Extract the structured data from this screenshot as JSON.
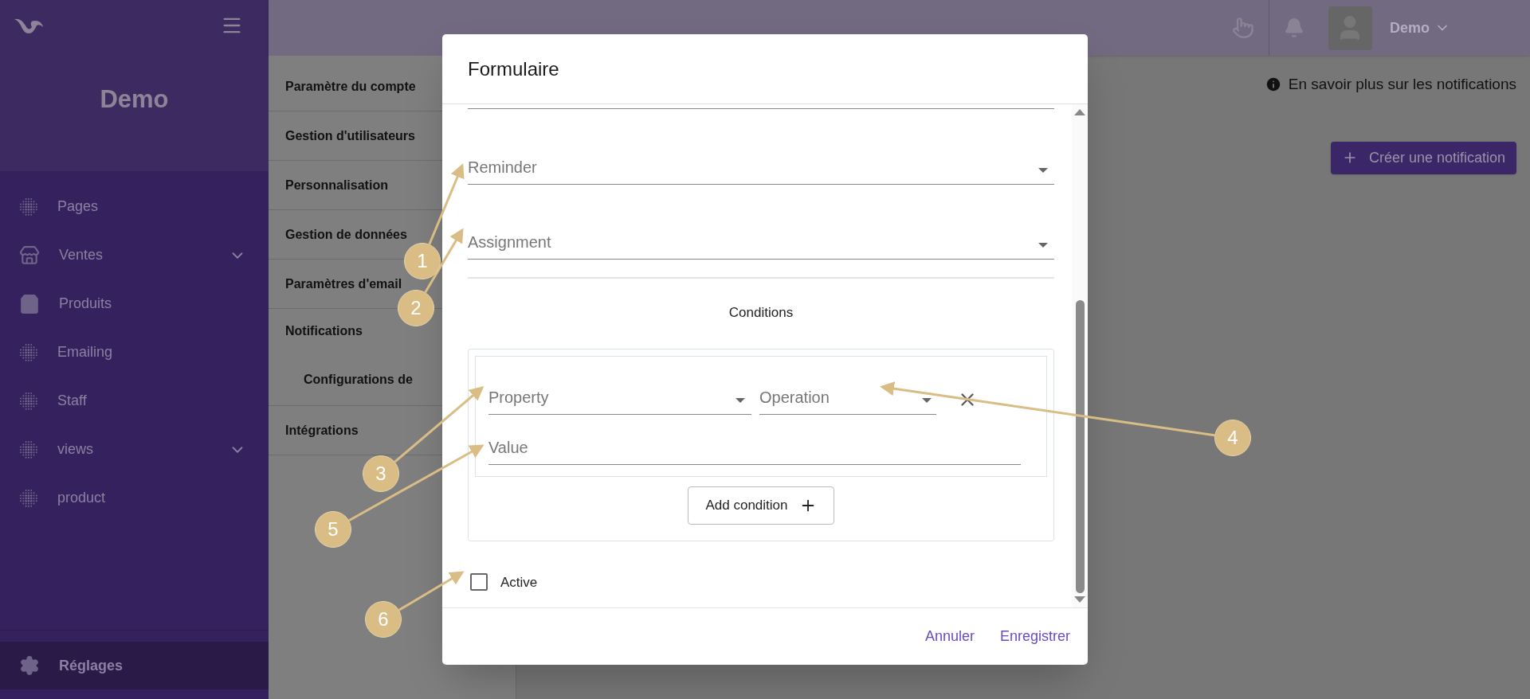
{
  "sidebar": {
    "title": "Demo",
    "items": [
      {
        "label": "Pages",
        "kind": "dots",
        "expandable": false,
        "selected": false
      },
      {
        "label": "Ventes",
        "kind": "store",
        "expandable": true,
        "selected": false
      },
      {
        "label": "Produits",
        "kind": "bag",
        "expandable": false,
        "selected": false
      },
      {
        "label": "Emailing",
        "kind": "dots",
        "expandable": false,
        "selected": false
      },
      {
        "label": "Staff",
        "kind": "dots",
        "expandable": false,
        "selected": false
      },
      {
        "label": "views",
        "kind": "dots",
        "expandable": true,
        "selected": false
      },
      {
        "label": "product",
        "kind": "dots",
        "expandable": false,
        "selected": false
      }
    ],
    "footer_item": {
      "label": "Réglages",
      "selected": true
    }
  },
  "topbar": {
    "user": "Demo"
  },
  "settings_menu": {
    "items": [
      {
        "label": "Paramètre du compte",
        "kind": "section"
      },
      {
        "label": "Gestion d'utilisateurs",
        "kind": "section"
      },
      {
        "label": "Personnalisation",
        "kind": "section"
      },
      {
        "label": "Gestion de données",
        "kind": "section"
      },
      {
        "label": "Paramètres d'email",
        "kind": "section"
      },
      {
        "label": "Notifications",
        "kind": "group"
      },
      {
        "label": "Configurations de",
        "kind": "subitem"
      },
      {
        "label": "Intégrations",
        "kind": "section"
      }
    ]
  },
  "main": {
    "info_link": "En savoir plus sur les notifications",
    "create_button": "Créer une notification"
  },
  "dialog": {
    "title": "Formulaire",
    "fields": [
      {
        "kind": "select",
        "placeholder": "Reminder"
      },
      {
        "kind": "select",
        "placeholder": "Assignment"
      }
    ],
    "conditions_heading": "Conditions",
    "condition": {
      "property": "Property",
      "operation": "Operation",
      "placeholder": "Value"
    },
    "add_condition": "Add condition",
    "active": {
      "label": "Active",
      "checked": false
    },
    "buttons": [
      "Annuler",
      "Enregistrer"
    ]
  },
  "annotations": [
    {
      "number": "1"
    },
    {
      "number": "2"
    },
    {
      "number": "3"
    },
    {
      "number": "4"
    },
    {
      "number": "5"
    },
    {
      "number": "6"
    }
  ]
}
